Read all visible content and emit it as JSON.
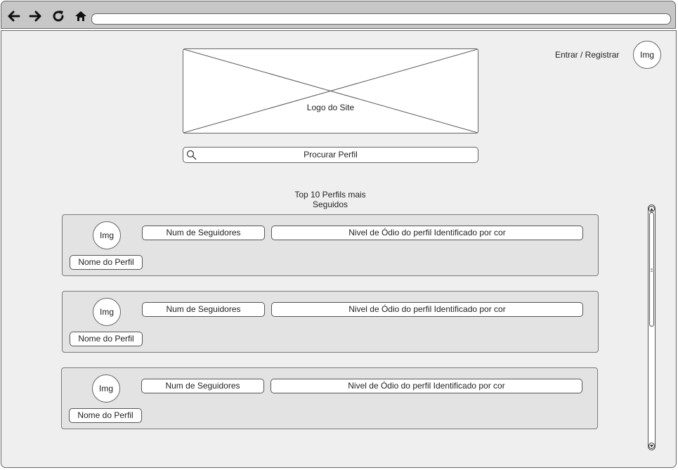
{
  "browser": {
    "back_icon": "arrow-left-icon",
    "forward_icon": "arrow-right-icon",
    "reload_icon": "reload-icon",
    "home_icon": "home-icon",
    "address": ""
  },
  "header": {
    "logo_label": "Logo do Site",
    "login_label": "Entrar / Registrar",
    "user_avatar_label": "Img"
  },
  "search": {
    "placeholder": "Procurar Perfil"
  },
  "section": {
    "title_line1": "Top 10 Perfils mais",
    "title_line2": "Seguidos"
  },
  "profiles": [
    {
      "avatar": "Img",
      "name": "Nome do Perfil",
      "followers": "Num de Seguidores",
      "hate_level": "Nivel de Ódio do perfil Identificado por cor"
    },
    {
      "avatar": "Img",
      "name": "Nome do Perfil",
      "followers": "Num de Seguidores",
      "hate_level": "Nivel de Ódio do perfil Identificado por cor"
    },
    {
      "avatar": "Img",
      "name": "Nome do Perfil",
      "followers": "Num de Seguidores",
      "hate_level": "Nivel de Ódio do perfil Identificado por cor"
    }
  ],
  "colors": {
    "toolbar": "#c7c7c7",
    "page_background": "#efefef",
    "card_background": "#e3e3e3"
  }
}
